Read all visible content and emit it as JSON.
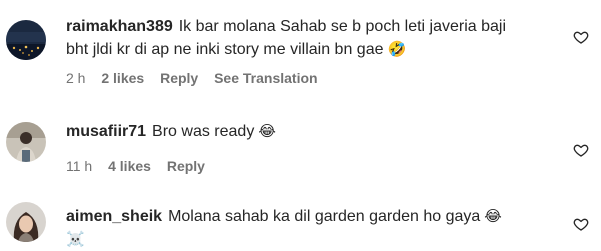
{
  "comments": [
    {
      "username": "raimakhan389",
      "text_line1": "Ik bar molana Sahab se b poch leti javeria baji",
      "text_line2": "bht jldi kr di ap ne inki story me villain bn gae",
      "emoji": "🤣",
      "time": "2 h",
      "likes": "2 likes",
      "reply": "Reply",
      "translation": "See Translation",
      "avatar_icon": "night-city-avatar-icon"
    },
    {
      "username": "musafiir71",
      "text_line1": "Bro was ready",
      "emoji": "😂",
      "time": "11 h",
      "likes": "4 likes",
      "reply": "Reply",
      "avatar_icon": "person-avatar-icon"
    },
    {
      "username": "aimen_sheik",
      "text_line1": "Molana sahab ka dil garden garden ho gaya",
      "emoji": "😂",
      "emoji2": "☠️",
      "avatar_icon": "girl-avatar-icon"
    }
  ],
  "colors": {
    "text": "#262626",
    "secondary": "#737373"
  }
}
